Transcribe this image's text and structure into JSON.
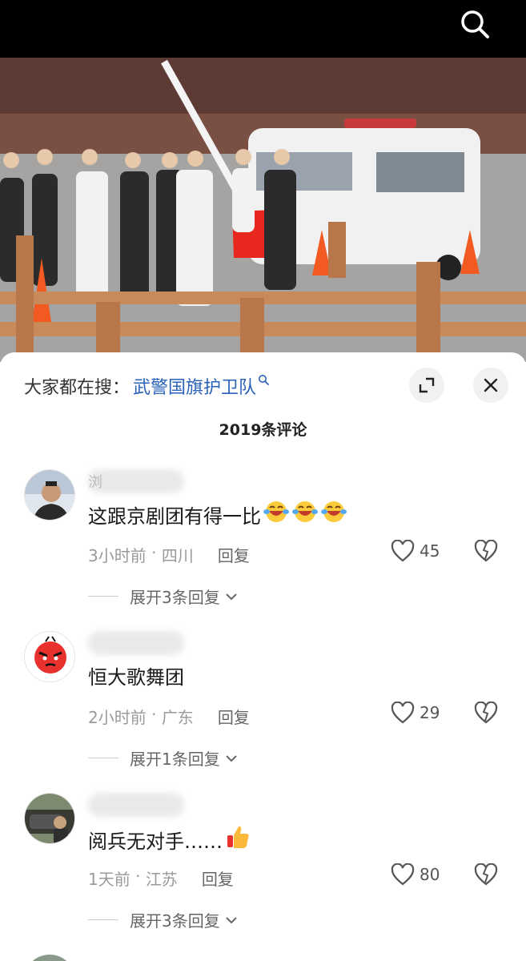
{
  "header": {
    "search_icon": "search-icon"
  },
  "video": {
    "description_none": ""
  },
  "hot_search": {
    "prefix": "大家都在搜：",
    "term": "武警国旗护卫队",
    "term_icon": "search-icon"
  },
  "sheet_controls": {
    "expand_icon": "expand-icon",
    "close_icon": "close-icon"
  },
  "comment_count": "2019条评论",
  "comments": [
    {
      "name_initial": "浏",
      "text": "这跟京剧团有得一比",
      "emoji_count": 3,
      "emoji": "laughing-crying-emoji",
      "time": "3小时前",
      "location": "四川",
      "reply_label": "回复",
      "likes": "45",
      "expand_label": "展开3条回复"
    },
    {
      "name_initial": "",
      "text": "恒大歌舞团",
      "emoji_count": 0,
      "emoji": "",
      "time": "2小时前",
      "location": "广东",
      "reply_label": "回复",
      "likes": "29",
      "expand_label": "展开1条回复"
    },
    {
      "name_initial": "",
      "text": "阅兵无对手……",
      "emoji_count": 1,
      "emoji": "thumbs-up-emoji",
      "time": "1天前",
      "location": "江苏",
      "reply_label": "回复",
      "likes": "80",
      "expand_label": "展开3条回复"
    }
  ],
  "colors": {
    "link": "#2a62b8",
    "meta": "#9a9a9a",
    "flag_red": "#e8281e"
  }
}
